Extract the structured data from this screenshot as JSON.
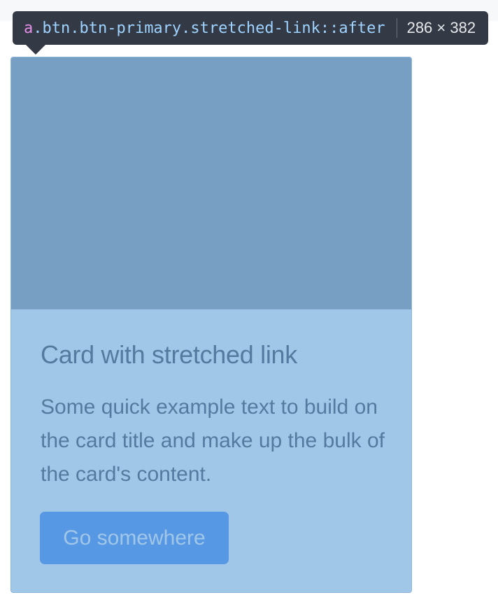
{
  "tooltip": {
    "tag": "a",
    "classes": ".btn.btn-primary.stretched-link::after",
    "size": "286 × 382"
  },
  "card": {
    "title": "Card with stretched link",
    "text": "Some quick example text to build on the card title and make up the bulk of the card's content.",
    "button_label": "Go somewhere"
  },
  "colors": {
    "highlight_overlay": "#6fa8dc",
    "button_primary": "#2b7af2",
    "card_image": "#868e96",
    "tooltip_bg": "#343a45"
  }
}
